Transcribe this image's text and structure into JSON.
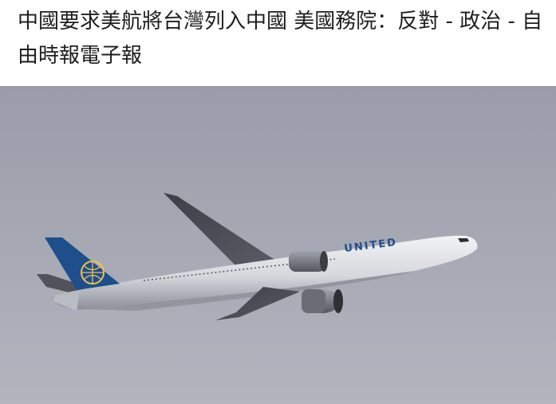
{
  "article": {
    "headline": "中國要求美航將台灣列入中國 美國務院：反對 - 政治 - 自由時報電子報",
    "image": {
      "fuselage_text": "UNITED"
    }
  },
  "colors": {
    "sky_top": "#9a9da9",
    "sky_bottom": "#b1b3bd",
    "tail_blue": "#1e4f8c",
    "fuselage": "#e9ebee",
    "text": "#1e1e1e"
  }
}
